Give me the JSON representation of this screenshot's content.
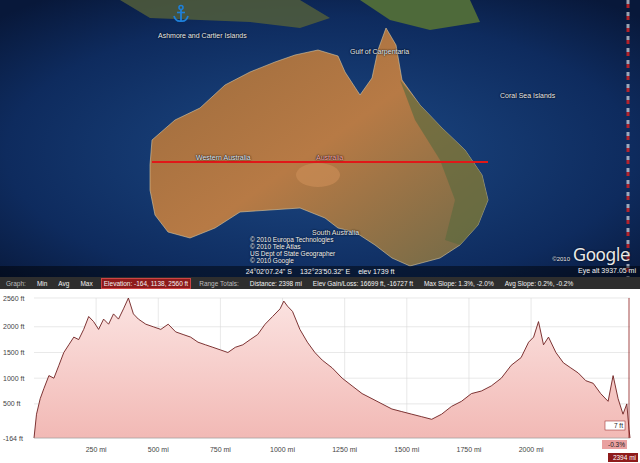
{
  "map": {
    "labels": [
      "Ashmore and Cartier Islands",
      "Gulf of Carpentaria",
      "Coral Sea Islands",
      "Western Australia",
      "Australia",
      "South Australia"
    ],
    "attribution": [
      "© 2010 Europa Technologies",
      "© 2010 Tele Atlas",
      "US Dept of State Geographer",
      "© 2010 Google"
    ],
    "status": {
      "latitude": "24°02'07.24\" S",
      "longitude": "132°23'50.32\" E",
      "elevation": "elev 1739 ft",
      "eye_alt": "Eye alt 3937.05 mi"
    },
    "logo": {
      "copyright": "©2010",
      "name": "Google"
    }
  },
  "graph": {
    "header": [
      {
        "text": "Graph:",
        "kind": "label",
        "selected": false
      },
      {
        "text": "Min",
        "kind": "option",
        "selected": false
      },
      {
        "text": "Avg",
        "kind": "option",
        "selected": false
      },
      {
        "text": "Max",
        "kind": "option",
        "selected": false
      },
      {
        "text": "Elevation: -164, 1138, 2560 ft",
        "kind": "value",
        "selected": true
      },
      {
        "text": "Range Totals:",
        "kind": "label",
        "selected": false
      },
      {
        "text": "Distance: 2398 mi",
        "kind": "value",
        "selected": false
      },
      {
        "text": "Elev Gain/Loss: 16699 ft, -16727 ft",
        "kind": "value",
        "selected": false
      },
      {
        "text": "Max Slope: 1.3%, -2.0%",
        "kind": "value",
        "selected": false
      },
      {
        "text": "Avg Slope: 0.2%, -0.2%",
        "kind": "value",
        "selected": false
      }
    ],
    "chart": {
      "y_ticks": [
        "2560 ft",
        "2000 ft",
        "1500 ft",
        "1000 ft",
        "500 ft",
        "-164 ft"
      ],
      "x_ticks": [
        "250 mi",
        "500 mi",
        "750 mi",
        "1000 mi",
        "1250 mi",
        "1500 mi",
        "1750 mi",
        "2000 mi"
      ],
      "x_max": 2398,
      "y_min": -164,
      "y_max": 2560,
      "series": [
        {
          "name": "Elevation",
          "distance_mi": [
            0,
            10,
            25,
            40,
            60,
            80,
            100,
            120,
            140,
            160,
            180,
            200,
            220,
            240,
            260,
            280,
            300,
            320,
            340,
            360,
            380,
            400,
            420,
            450,
            480,
            510,
            540,
            570,
            600,
            630,
            660,
            690,
            720,
            750,
            780,
            810,
            840,
            870,
            900,
            930,
            960,
            990,
            1005,
            1020,
            1040,
            1070,
            1100,
            1130,
            1160,
            1200,
            1240,
            1280,
            1320,
            1360,
            1400,
            1440,
            1480,
            1520,
            1560,
            1600,
            1640,
            1680,
            1720,
            1760,
            1800,
            1840,
            1880,
            1920,
            1960,
            1990,
            2010,
            2030,
            2050,
            2070,
            2100,
            2130,
            2160,
            2190,
            2220,
            2250,
            2280,
            2310,
            2330,
            2350,
            2370,
            2385,
            2394,
            2398
          ],
          "elevation_ft": [
            -164,
            300,
            600,
            800,
            1050,
            1000,
            1250,
            1500,
            1650,
            1800,
            1750,
            1950,
            2200,
            2100,
            1950,
            2150,
            2050,
            2250,
            2150,
            2350,
            2560,
            2250,
            2150,
            2050,
            2000,
            1950,
            2050,
            1900,
            1850,
            1800,
            1700,
            1650,
            1600,
            1550,
            1500,
            1600,
            1650,
            1750,
            1850,
            2050,
            2200,
            2350,
            2500,
            2400,
            2300,
            1950,
            1700,
            1500,
            1350,
            1200,
            1000,
            850,
            700,
            600,
            500,
            400,
            350,
            300,
            250,
            200,
            300,
            450,
            550,
            700,
            750,
            850,
            1000,
            1250,
            1400,
            1700,
            1800,
            2100,
            1650,
            1800,
            1500,
            1300,
            1200,
            1100,
            950,
            900,
            700,
            550,
            1050,
            600,
            300,
            500,
            7,
            -164
          ]
        }
      ],
      "cursor": {
        "distance_mi": 2394,
        "distance": "2394 mi",
        "elevation": "7 ft",
        "slope": "-0.3%"
      }
    }
  }
}
